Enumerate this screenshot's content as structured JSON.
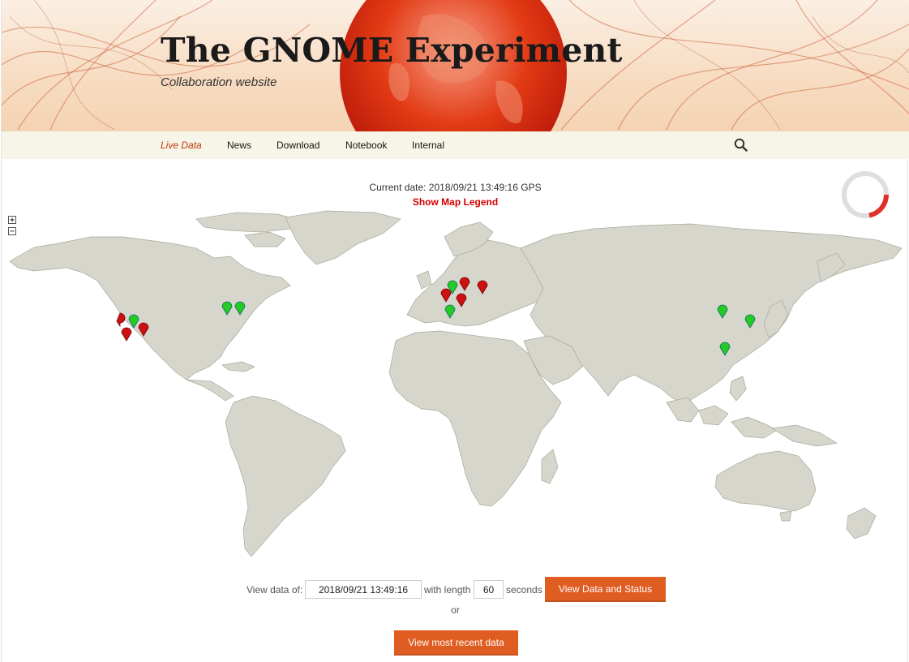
{
  "site": {
    "title": "The GNOME Experiment",
    "tagline": "Collaboration website"
  },
  "nav": {
    "items": [
      {
        "label": "Live Data",
        "active": true
      },
      {
        "label": "News"
      },
      {
        "label": "Download"
      },
      {
        "label": "Notebook"
      },
      {
        "label": "Internal"
      }
    ],
    "search_icon": "search-icon"
  },
  "status": {
    "current_date": "Current date: 2018/09/21 13:49:16 GPS",
    "legend_link": "Show Map Legend"
  },
  "map": {
    "zoom_in": "+",
    "zoom_out": "−",
    "land_color": "#d6d6cc",
    "ocean_color": "#ffffff",
    "marker_colors": {
      "ok": "#22cc22",
      "issue": "#cc1111"
    }
  },
  "form": {
    "view_data_of_label": "View data of:",
    "date_value": "2018/09/21 13:49:16",
    "with_length_label": "with length",
    "length_value": "60",
    "seconds_label": "seconds",
    "view_button": "View Data and Status",
    "or_text": "or",
    "recent_button": "View most recent data"
  },
  "colors": {
    "accent": "#e05d22",
    "nav_bg": "#f7f5e7",
    "active_nav": "#bc360a",
    "legend_red": "#d40000"
  }
}
